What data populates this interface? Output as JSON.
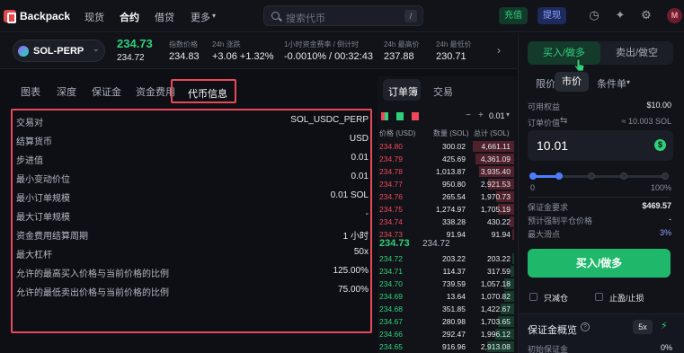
{
  "nav": {
    "brand": "Backpack",
    "links": [
      "现货",
      "合约",
      "借贷",
      "更多"
    ],
    "search_placeholder": "搜索代币",
    "search_shortcut": "/",
    "deposit": "充值",
    "withdraw": "提现",
    "avatar_initial": "M"
  },
  "ticker": {
    "market": "SOL-PERP",
    "last_price": "234.73",
    "last_price_sub": "234.72",
    "index_label": "指数价格",
    "index_value": "234.83",
    "change_label": "24h 涨跌",
    "change_value": "+3.06 +1.32%",
    "funding_label": "1小时资金费率 / 倒计时",
    "funding_rate": "-0.0010%",
    "funding_countdown": "/ 00:32:43",
    "high_label": "24h 最高价",
    "high_value": "237.88",
    "low_label": "24h 最低价",
    "low_value": "230.71"
  },
  "left_tabs": [
    "图表",
    "深度",
    "保证金",
    "资金费用",
    "代币信息"
  ],
  "token_info": [
    {
      "label": "交易对",
      "value": "SOL_USDC_PERP"
    },
    {
      "label": "结算货币",
      "value": "USD"
    },
    {
      "label": "步进值",
      "value": "0.01"
    },
    {
      "label": "最小变动价位",
      "value": "0.01"
    },
    {
      "label": "最小订单规模",
      "value": "0.01 SOL"
    },
    {
      "label": "最大订单规模",
      "value": "-"
    },
    {
      "label": "资金费用结算周期",
      "value": "1 小时"
    },
    {
      "label": "最大杠杆",
      "value": "50x"
    },
    {
      "label": "允许的最高买入价格与当前价格的比例",
      "value": "125.00%"
    },
    {
      "label": "允许的最低卖出价格与当前价格的比例",
      "value": "75.00%"
    }
  ],
  "orderbook": {
    "tabs": [
      "订单簿",
      "交易"
    ],
    "tick": "0.01",
    "headers": [
      "价格 (USD)",
      "数量 (SOL)",
      "总计 (SOL)"
    ],
    "asks": [
      {
        "price": "234.80",
        "size": "300.02",
        "total": "4,661.11",
        "depth": 0.92
      },
      {
        "price": "234.79",
        "size": "425.69",
        "total": "4,361.09",
        "depth": 0.86
      },
      {
        "price": "234.78",
        "size": "1,013.87",
        "total": "3,935.40",
        "depth": 0.78
      },
      {
        "price": "234.77",
        "size": "950.80",
        "total": "2,921.53",
        "depth": 0.58
      },
      {
        "price": "234.76",
        "size": "265.54",
        "total": "1,970.73",
        "depth": 0.4
      },
      {
        "price": "234.75",
        "size": "1,274.97",
        "total": "1,705.19",
        "depth": 0.35
      },
      {
        "price": "234.74",
        "size": "338.28",
        "total": "430.22",
        "depth": 0.1
      },
      {
        "price": "234.73",
        "size": "91.94",
        "total": "91.94",
        "depth": 0.03
      }
    ],
    "mid_price": "234.73",
    "mid_sub": "234.72",
    "bids": [
      {
        "price": "234.72",
        "size": "203.22",
        "total": "203.22",
        "depth": 0.04
      },
      {
        "price": "234.71",
        "size": "114.37",
        "total": "317.59",
        "depth": 0.07
      },
      {
        "price": "234.70",
        "size": "739.59",
        "total": "1,057.18",
        "depth": 0.22
      },
      {
        "price": "234.69",
        "size": "13.64",
        "total": "1,070.82",
        "depth": 0.22
      },
      {
        "price": "234.68",
        "size": "351.85",
        "total": "1,422.67",
        "depth": 0.3
      },
      {
        "price": "234.67",
        "size": "280.98",
        "total": "1,703.65",
        "depth": 0.35
      },
      {
        "price": "234.66",
        "size": "292.47",
        "total": "1,996.12",
        "depth": 0.42
      },
      {
        "price": "234.65",
        "size": "916.96",
        "total": "2,913.08",
        "depth": 0.6
      }
    ]
  },
  "trade": {
    "buy_label": "买入/做多",
    "sell_label": "卖出/做空",
    "order_types": [
      "限价",
      "市价",
      "条件单"
    ],
    "available_label": "可用权益",
    "available_value": "$10.00",
    "order_value_label": "订单价值",
    "order_value_hint": "≈ 10.003 SOL",
    "order_value_input": "10.01",
    "slider_min": "0",
    "slider_max": "100%",
    "margin_req_label": "保证金要求",
    "margin_req_value": "$469.57",
    "liq_label": "预计强制平仓价格",
    "liq_value": "-",
    "slippage_label": "最大滑点",
    "slippage_value": "3%",
    "submit_label": "买入/做多",
    "reduce_only": "只减仓",
    "tp_sl": "止盈/止损",
    "margin_overview": "保证金概览",
    "leverage_badge": "5x",
    "initial_margin_label": "初始保证金",
    "initial_margin_value": "0%"
  },
  "colors": {
    "ask": "#f0475c",
    "bid": "#2fd07a",
    "highlight": "#e64a5a",
    "accent": "#4d7cff"
  }
}
